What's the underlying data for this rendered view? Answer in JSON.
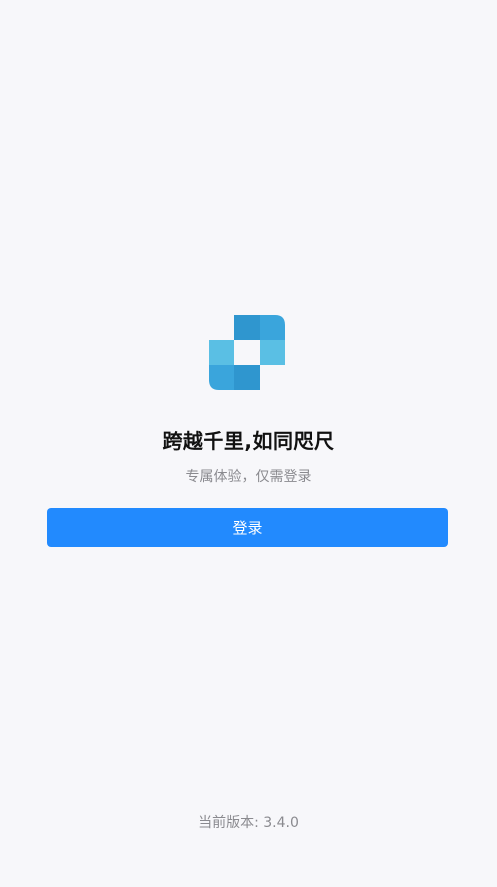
{
  "brand": {
    "logo_icon": "tiled-square-logo-icon",
    "colors": {
      "tile_dark": "#2f96cf",
      "tile_mid": "#3aa5dc",
      "tile_light": "#5abfe4"
    }
  },
  "hero": {
    "tagline": "跨越千里,如同咫尺",
    "subtitle": "专属体验，仅需登录"
  },
  "login": {
    "button_label": "登录",
    "accent_color": "#228afe"
  },
  "footer": {
    "version_label": "当前版本:",
    "version_value": "3.4.0"
  }
}
